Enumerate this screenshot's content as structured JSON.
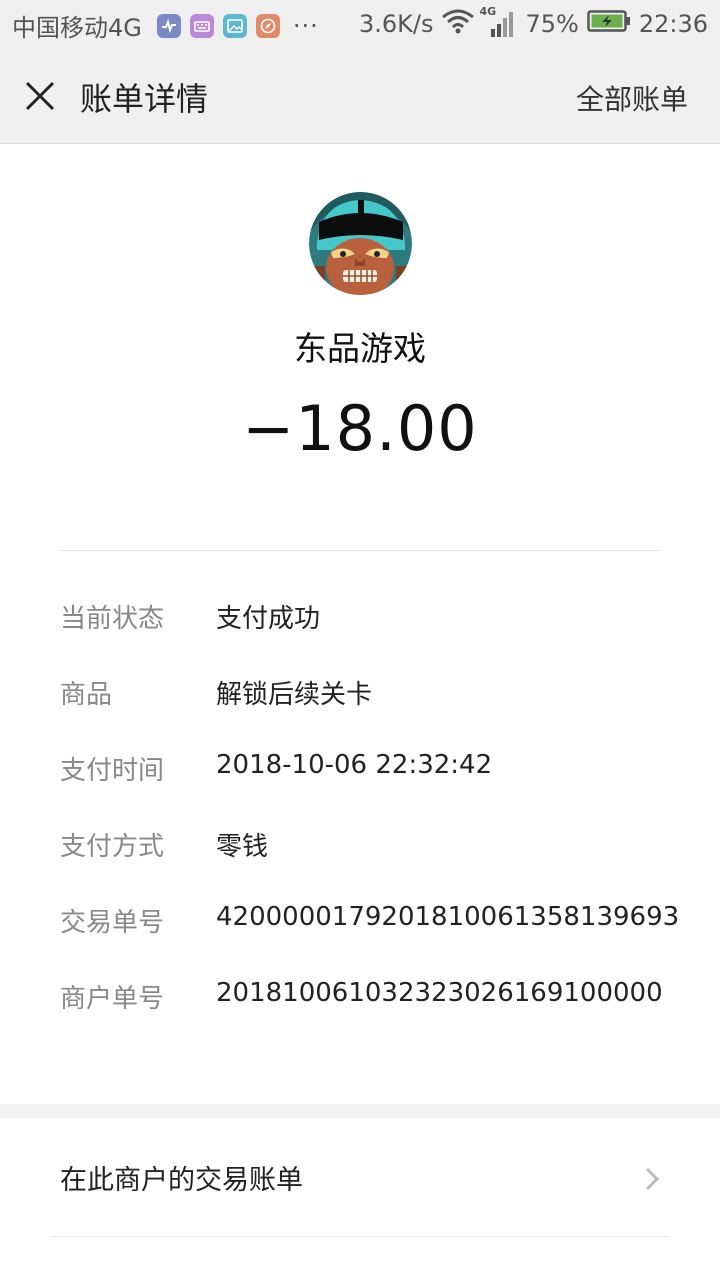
{
  "status_bar": {
    "carrier": "中国移动4G",
    "more": "···",
    "speed": "3.6K/s",
    "network_label": "4G",
    "battery_percent": "75%",
    "time": "22:36",
    "app_icons": [
      "health-app-icon",
      "keyboard-app-icon",
      "gallery-app-icon",
      "compass-app-icon"
    ],
    "app_icon_colors": [
      "#7b89c6",
      "#b98ad8",
      "#5fb6cf",
      "#e08a69"
    ],
    "battery_color": "#6ab04c"
  },
  "header": {
    "close_icon": "close-icon",
    "title": "账单详情",
    "all_bills_label": "全部账单"
  },
  "summary": {
    "merchant_name": "东品游戏",
    "amount": "−18.00"
  },
  "details": [
    {
      "label": "当前状态",
      "value": "支付成功"
    },
    {
      "label": "商品",
      "value": "解锁后续关卡"
    },
    {
      "label": "支付时间",
      "value": "2018-10-06 22:32:42"
    },
    {
      "label": "支付方式",
      "value": "零钱"
    },
    {
      "label": "交易单号",
      "value": "4200000179201810061358139693"
    },
    {
      "label": "商户单号",
      "value": "201810061032323026169100000"
    }
  ],
  "merchant_bills": {
    "label": "在此商户的交易账单",
    "chevron_icon": "chevron-right-icon"
  }
}
